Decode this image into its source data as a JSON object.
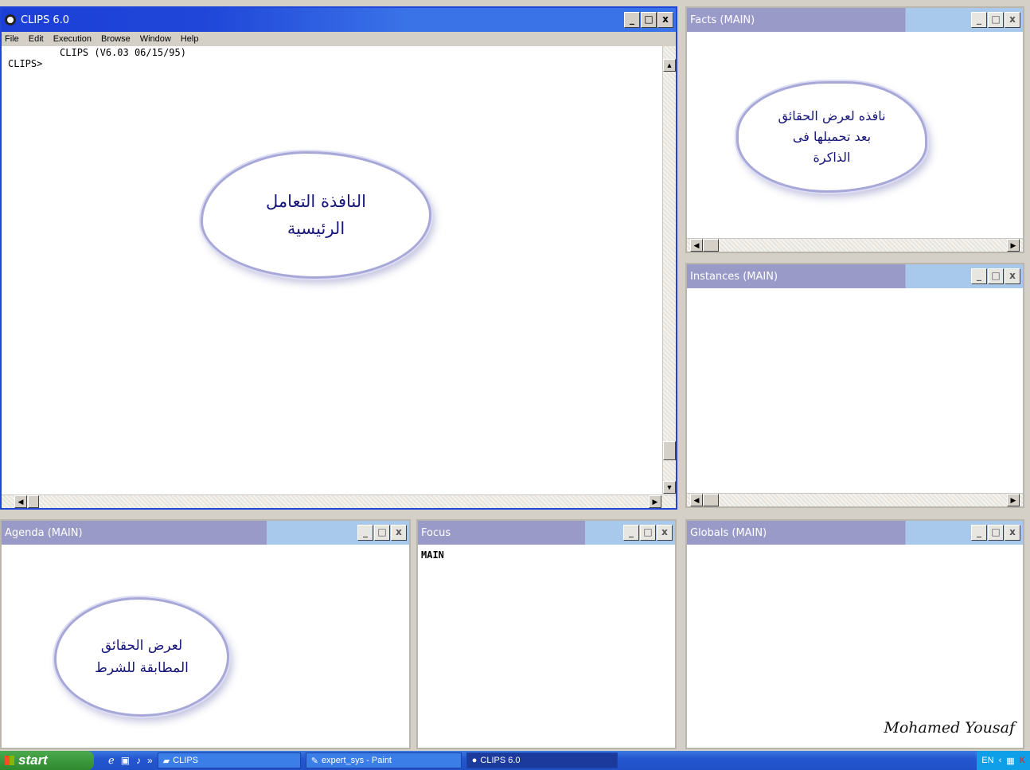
{
  "main_window": {
    "title": "CLIPS 6.0",
    "menu": [
      "File",
      "Edit",
      "Execution",
      "Browse",
      "Window",
      "Help"
    ],
    "banner": "         CLIPS (V6.03 06/15/95)",
    "prompt": "CLIPS>",
    "annotation": "النافذة التعامل الرئيسية"
  },
  "facts_window": {
    "title": "Facts (MAIN)",
    "annotation": "نافذه لعرض الحقائق بعد تحميلها فى الذاكرة"
  },
  "instances_window": {
    "title": "Instances (MAIN)"
  },
  "agenda_window": {
    "title": "Agenda (MAIN)",
    "annotation": "لعرض الحقائق المطابقة للشرط"
  },
  "focus_window": {
    "title": "Focus",
    "content": "MAIN"
  },
  "globals_window": {
    "title": "Globals (MAIN)",
    "signature": "Mohamed Yousaf"
  },
  "taskbar": {
    "start_label": "start",
    "tasks": [
      "CLIPS",
      "expert_sys - Paint",
      "CLIPS 6.0"
    ],
    "language": "EN"
  },
  "window_buttons": {
    "minimize": "_",
    "maximize": "□",
    "close": "x"
  },
  "colors": {
    "active_title": "#1f46d8",
    "inactive_title": "#9a9ac8",
    "cloud_text": "#15157a"
  }
}
